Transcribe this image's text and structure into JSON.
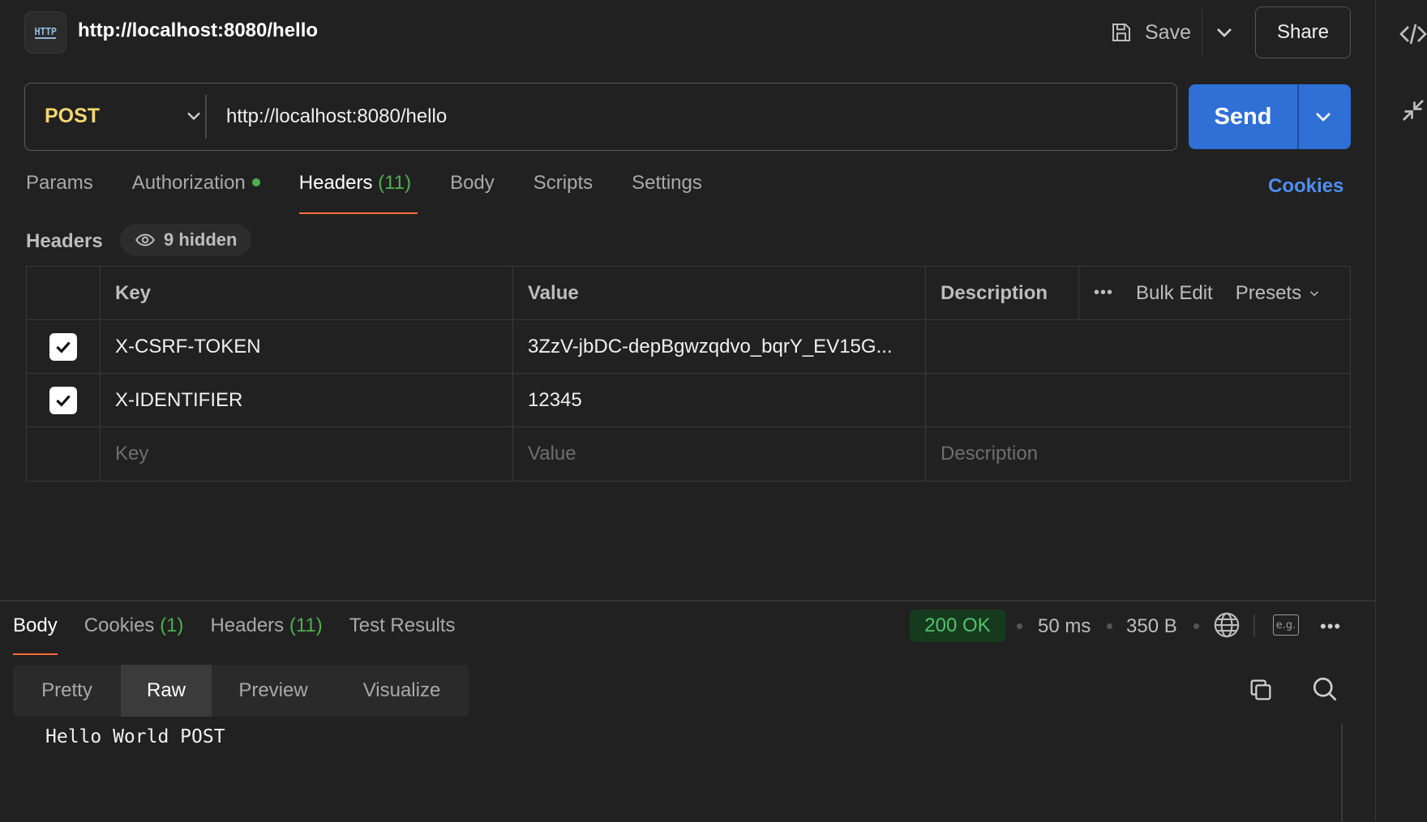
{
  "header": {
    "icon_label": "HTTP",
    "title": "http://localhost:8080/hello",
    "save_label": "Save",
    "share_label": "Share"
  },
  "request": {
    "method": "POST",
    "url": "http://localhost:8080/hello",
    "send_label": "Send"
  },
  "request_tabs": [
    {
      "label": "Params",
      "count": ""
    },
    {
      "label": "Authorization",
      "count": ""
    },
    {
      "label": "Headers",
      "count": "(11)"
    },
    {
      "label": "Body",
      "count": ""
    },
    {
      "label": "Scripts",
      "count": ""
    },
    {
      "label": "Settings",
      "count": ""
    }
  ],
  "active_request_tab": "Headers",
  "cookies_link": "Cookies",
  "headers_section": {
    "label": "Headers",
    "hidden_label": "9 hidden",
    "columns": {
      "key": "Key",
      "value": "Value",
      "description": "Description",
      "bulk_edit": "Bulk Edit",
      "presets": "Presets"
    },
    "rows": [
      {
        "enabled": true,
        "key": "X-CSRF-TOKEN",
        "value": "3ZzV-jbDC-depBgwzqdvo_bqrY_EV15G...",
        "description": ""
      },
      {
        "enabled": true,
        "key": "X-IDENTIFIER",
        "value": "12345",
        "description": ""
      }
    ],
    "placeholders": {
      "key": "Key",
      "value": "Value",
      "description": "Description"
    }
  },
  "response": {
    "tabs": [
      {
        "label": "Body",
        "count": ""
      },
      {
        "label": "Cookies",
        "count": "(1)"
      },
      {
        "label": "Headers",
        "count": "(11)"
      },
      {
        "label": "Test Results",
        "count": ""
      }
    ],
    "active_tab": "Body",
    "status": "200 OK",
    "time": "50 ms",
    "size": "350 B",
    "view_modes": [
      "Pretty",
      "Raw",
      "Preview",
      "Visualize"
    ],
    "active_view": "Raw",
    "body": "Hello World POST"
  },
  "colors": {
    "accent_tab": "#ff6c37",
    "send_button": "#2f6fd6",
    "method_post": "#f5d76e",
    "status_ok": "#52c26b",
    "link": "#4d8ff0"
  },
  "icons": [
    "http-icon",
    "save-icon",
    "chevron-down-icon",
    "eye-icon",
    "checkbox-checked-icon",
    "more-icon",
    "globe-icon",
    "example-icon",
    "copy-icon",
    "search-icon",
    "code-icon",
    "collapse-icon"
  ]
}
